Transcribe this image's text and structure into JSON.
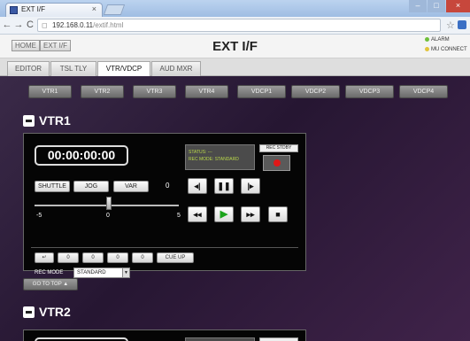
{
  "browser": {
    "tab_title": "EXT I/F",
    "tab_close": "×",
    "url_host": "192.168.0.11",
    "url_path": "/extif.html",
    "win_min": "–",
    "win_max": "□",
    "win_close": "×"
  },
  "header": {
    "home_label": "HOME",
    "extif_label": "EXT I/F",
    "title": "EXT I/F",
    "alarm_label": "ALARM",
    "mu_connect_label": "MU CONNECT",
    "alarm_color": "#6fbf3a",
    "mu_connect_color": "#e2c43a"
  },
  "tabs": [
    "EDITOR",
    "TSL TLY",
    "VTR/VDCP",
    "AUD MXR"
  ],
  "active_tab": "VTR/VDCP",
  "device_buttons": [
    "VTR1",
    "VTR2",
    "VTR3",
    "VTR4",
    "VDCP1",
    "VDCP2",
    "VDCP3",
    "VDCP4"
  ],
  "vtr1": {
    "title": "VTR1",
    "timecode": "00:00:00:00",
    "status_line1": "STATUS: ---",
    "status_line2": "REC MODE: STANDARD",
    "rec_stdby_label": "REC STDBY",
    "shuttle_label": "SHUTTLE",
    "jog_label": "JOG",
    "var_label": "VAR",
    "var_value": "0",
    "scale_min": "-5",
    "scale_mid": "0",
    "scale_max": "5",
    "slider_value": 0,
    "cue_fields": [
      "0",
      "0",
      "0",
      "0"
    ],
    "cue_up_label": "CUE UP",
    "rec_mode_label": "REC MODE",
    "rec_mode_value": "STANDARD"
  },
  "goto_top_label": "GO TO TOP ▲",
  "vtr2": {
    "title": "VTR2"
  }
}
